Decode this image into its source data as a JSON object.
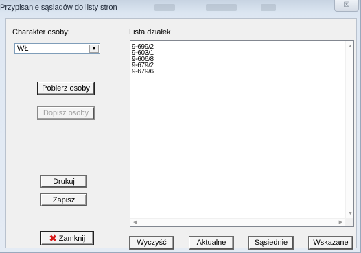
{
  "window": {
    "title": "Przypisanie sąsiadów do listy stron",
    "close_glyph": "☒"
  },
  "left_panel": {
    "charakter_label": "Charakter osoby:",
    "charakter_value": "WŁ",
    "pobierz_label": "Pobierz osoby",
    "dopisz_label": "Dopisz osoby",
    "drukuj_label": "Drukuj",
    "zapisz_label": "Zapisz",
    "zamknij_label": "Zamknij"
  },
  "right_panel": {
    "list_label": "Lista działek",
    "items": [
      "9-699/2",
      "9-603/1",
      "9-606/8",
      "9-679/2",
      "9-679/6"
    ]
  },
  "bottom_buttons": {
    "wyczysc_label": "Wyczyść",
    "aktualne_label": "Aktualne",
    "sasiednie_label": "Sąsiednie",
    "wskazane_label": "Wskazane"
  },
  "icons": {
    "combo_arrow": "▼",
    "close_icon": "✖",
    "scroll_up": "▲",
    "scroll_down": "▼",
    "scroll_left": "◀",
    "scroll_right": "▶"
  },
  "colors": {
    "close_icon": "#d81818",
    "client_bg": "#f0f0f0",
    "list_bg": "#ffffff"
  }
}
